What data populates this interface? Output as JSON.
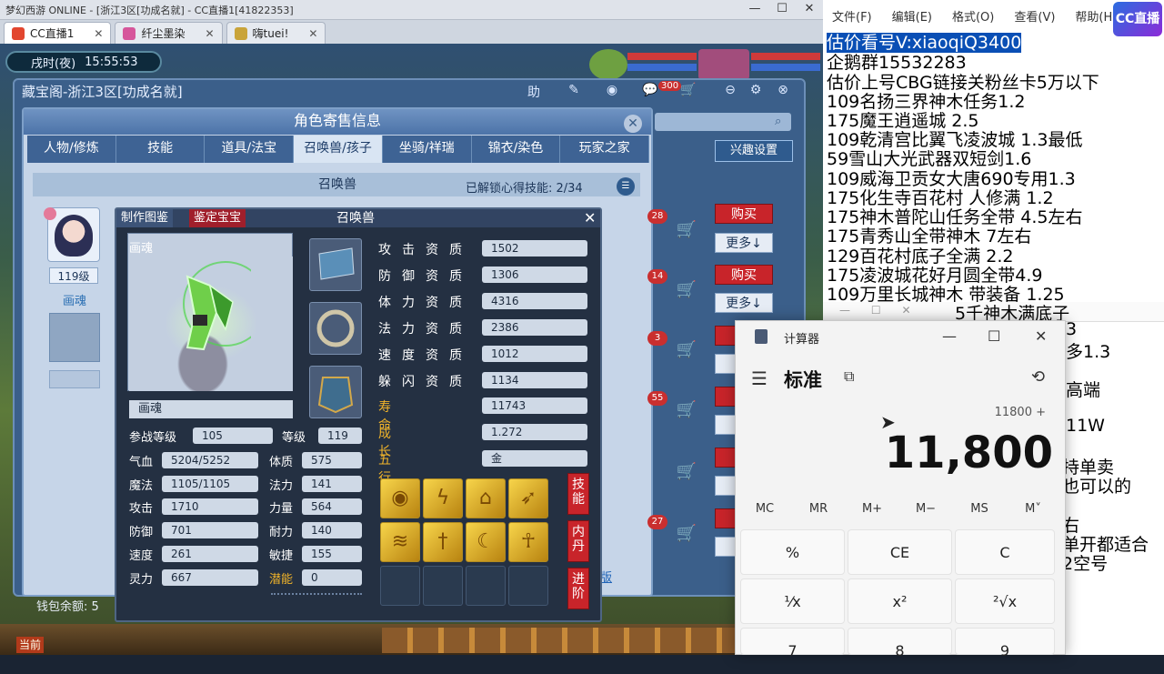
{
  "os": {
    "title": "梦幻西游 ONLINE - [浙江3区[功成名就] - CC直播1[41822353]"
  },
  "tabs": [
    {
      "label": "CC直播1",
      "active": true
    },
    {
      "label": "纤尘墨染",
      "active": false
    },
    {
      "label": "嗨tuei!",
      "active": false
    }
  ],
  "game": {
    "clock_period": "戌时(夜)",
    "clock_time": "15:55:53",
    "window_title": "藏宝阁-浙江3区[功成名就]",
    "help_label": "助",
    "mail_count": "300",
    "panel_title": "角色寄售信息",
    "subtabs": [
      "人物/修炼",
      "技能",
      "道具/法宝",
      "召唤兽/孩子",
      "坐骑/祥瑞",
      "锦衣/染色",
      "玩家之家"
    ],
    "interest_button": "兴趣设置",
    "pet_section_title": "召唤兽",
    "skill_unlock": "已解锁心得技能: 2/34",
    "avatar_level": "119级",
    "avatar_name": "画魂",
    "list_badges": [
      "28",
      "14",
      "3",
      "55",
      "",
      "27"
    ],
    "buy_label": "购买",
    "more_label": "更多↓",
    "wallet_label": "钱包余额: 5",
    "page_link": "版",
    "popup": {
      "btn_codex": "制作图鉴",
      "btn_appraise": "鉴定宝宝",
      "title": "召唤兽",
      "pet_label": "画魂",
      "pet_name": "画魂",
      "battle_level_label": "参战等级",
      "battle_level": "105",
      "level_label": "等级",
      "level": "119",
      "stats": [
        {
          "label": "气血",
          "value": "5204/5252",
          "label2": "体质",
          "value2": "575"
        },
        {
          "label": "魔法",
          "value": "1105/1105",
          "label2": "法力",
          "value2": "141"
        },
        {
          "label": "攻击",
          "value": "1710",
          "label2": "力量",
          "value2": "564"
        },
        {
          "label": "防御",
          "value": "701",
          "label2": "耐力",
          "value2": "140"
        },
        {
          "label": "速度",
          "value": "261",
          "label2": "敏捷",
          "value2": "155"
        },
        {
          "label": "灵力",
          "value": "667",
          "label2": "潜能",
          "value2": "0"
        }
      ],
      "aptitudes": [
        {
          "label": "攻击资质",
          "value": "1502"
        },
        {
          "label": "防御资质",
          "value": "1306"
        },
        {
          "label": "体力资质",
          "value": "4316"
        },
        {
          "label": "法力资质",
          "value": "2386"
        },
        {
          "label": "速度资质",
          "value": "1012"
        },
        {
          "label": "躲闪资质",
          "value": "1134"
        },
        {
          "label": "寿命",
          "value": "11743"
        },
        {
          "label": "成长",
          "value": "1.272"
        },
        {
          "label": "五行",
          "value": "金"
        }
      ],
      "side_buttons": [
        "技能",
        "内丹",
        "进阶"
      ]
    }
  },
  "notepad": {
    "menu": [
      "文件(F)",
      "编辑(E)",
      "格式(O)",
      "查看(V)",
      "帮助(H)"
    ],
    "logo": "CC直播",
    "lines": [
      "估价看号V:xiaoqiQ3400",
      "企鹅群15532283",
      "估价上号CBG链接关粉丝卡5万以下",
      "109名扬三界神木任务1.2",
      "175魔王逍遥城 2.5",
      "109乾清宫比翼飞凌波城 1.3最低",
      "59雪山大光武器双短剑1.6",
      "109威海卫贡女大唐690专用1.3",
      "175化生寺百花村 人修满 1.2",
      "175神木普陀山任务全带 4.5左右",
      "175青秀山全带神木  7左右",
      "129百花村底子全满 2.2",
      "175凌波城花好月圆全带4.9",
      "109万里长城神木  带装备  1.25",
      "5千神木满底子",
      "3",
      "多1.3",
      "高端",
      "11W",
      "持单卖",
      "也可以的",
      "右",
      "单开都适合",
      "2空号"
    ]
  },
  "calculator": {
    "title": "计算器",
    "mode": "标准",
    "expression": "11800 +",
    "display": "11,800",
    "memory": [
      "MC",
      "MR",
      "M+",
      "M−",
      "MS",
      "M˅"
    ],
    "keys_row1": [
      "%",
      "CE",
      "C",
      "⌫"
    ],
    "keys_row2": [
      "¹⁄x",
      "x²",
      "²√x",
      "÷"
    ],
    "keys_row3": [
      "7",
      "8",
      "9",
      "×"
    ]
  }
}
